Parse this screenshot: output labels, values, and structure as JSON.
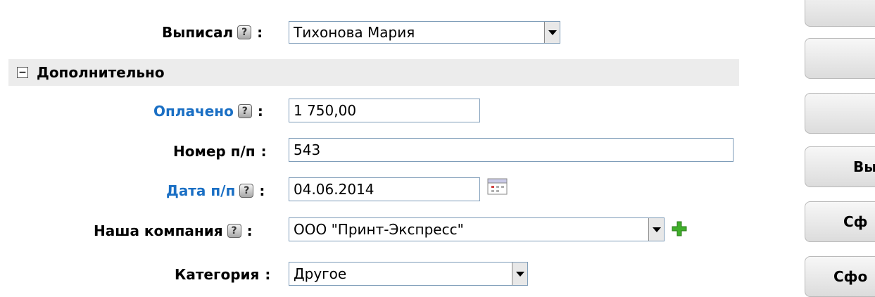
{
  "form": {
    "issued_by": {
      "label": "Выписал",
      "colon": ":",
      "value": "Тихонова Мария"
    },
    "section": {
      "toggle": "−",
      "title": "Дополнительно"
    },
    "paid": {
      "label": "Оплачено",
      "colon": ":",
      "value": "1 750,00"
    },
    "payment_number": {
      "label": "Номер п/п",
      "colon": ":",
      "value": "543"
    },
    "payment_date": {
      "label": "Дата п/п",
      "colon": ":",
      "value": "04.06.2014"
    },
    "our_company": {
      "label": "Наша компания",
      "colon": ":",
      "value": "ООО \"Принт-Экспресс\""
    },
    "category": {
      "label": "Категория",
      "colon": ":",
      "value": "Другое"
    }
  },
  "help_glyph": "?",
  "sidebar": {
    "buttons": [
      "",
      "",
      "",
      "Вы",
      "Сф",
      "Сфо"
    ]
  },
  "colors": {
    "link": "#1a6fc4",
    "section_bg": "#ececec",
    "plus": "#3fae2a"
  }
}
